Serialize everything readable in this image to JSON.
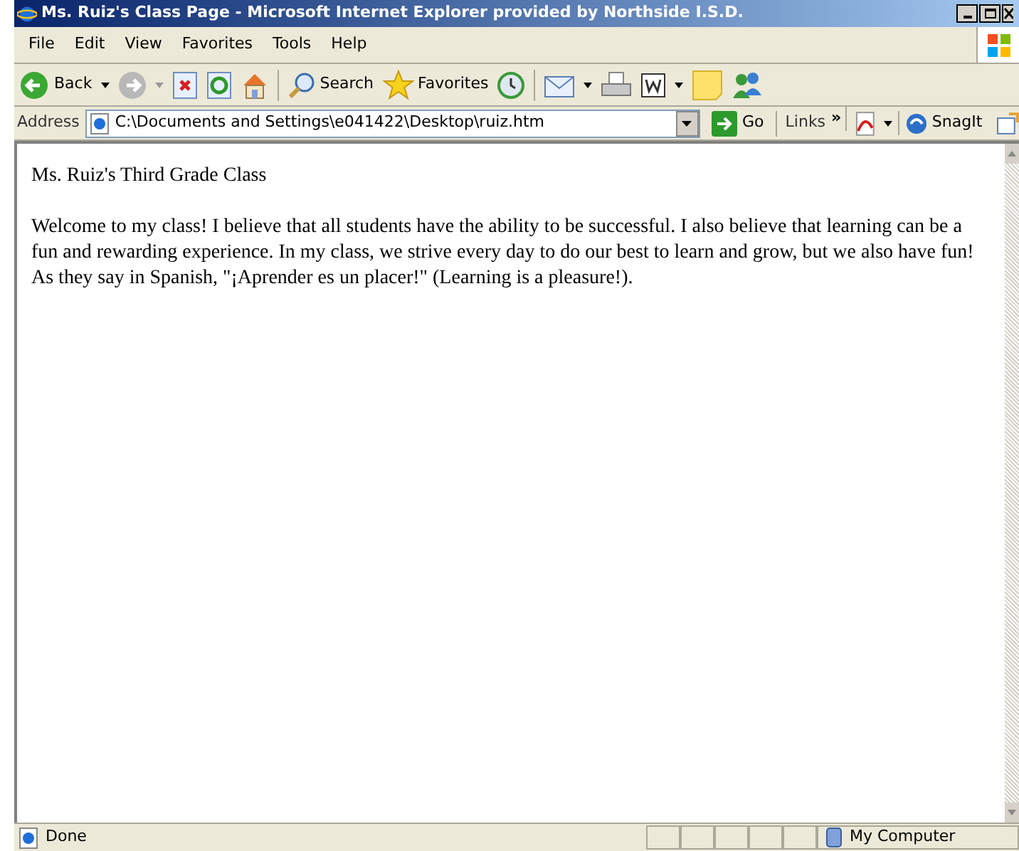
{
  "window": {
    "title": "Ms. Ruiz's Class Page - Microsoft Internet Explorer provided by Northside I.S.D."
  },
  "menu": [
    "File",
    "Edit",
    "View",
    "Favorites",
    "Tools",
    "Help"
  ],
  "toolbar": {
    "back": "Back",
    "search": "Search",
    "favorites": "Favorites"
  },
  "address_bar": {
    "label": "Address",
    "value": "C:\\Documents and Settings\\e041422\\Desktop\\ruiz.htm",
    "go": "Go",
    "links": "Links",
    "chevron": "»",
    "snagit": "SnagIt"
  },
  "page": {
    "heading": "Ms. Ruiz's Third Grade Class",
    "paragraph": "Welcome to my class! I believe that all students have the ability to be successful. I also believe that learning can be a fun and rewarding experience. In my class, we strive every day to do our best to learn and grow, but we also have fun! As they say in Spanish, \"¡Aprender es un placer!\" (Learning is a pleasure!)."
  },
  "status_bar": {
    "text": "Done",
    "zone": "My Computer"
  }
}
